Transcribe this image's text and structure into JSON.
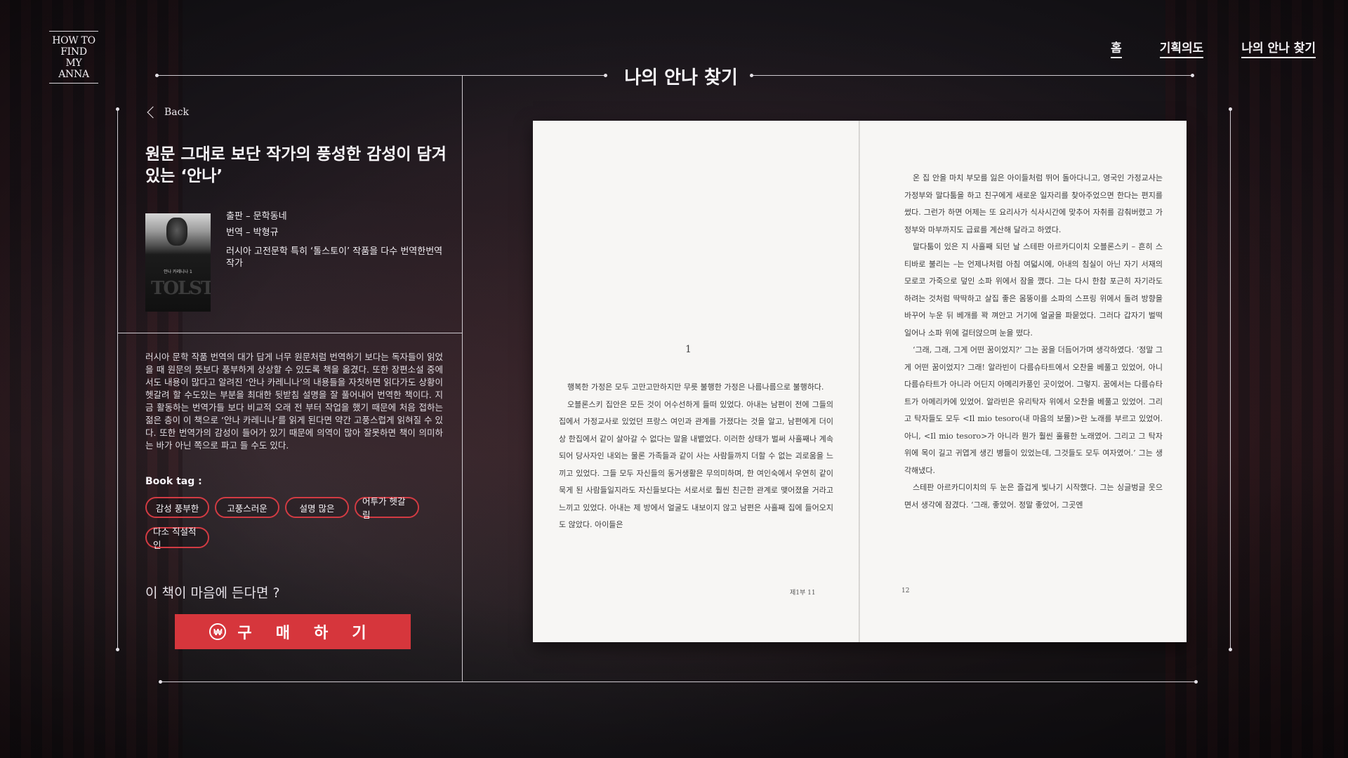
{
  "logo": {
    "line1": "HOW TO",
    "line2": "FIND",
    "line3": "MY ANNA"
  },
  "nav": {
    "home": "홈",
    "plan": "기획의도",
    "find": "나의 안나 찾기"
  },
  "page_title": "나의 안나 찾기",
  "back_label": "Back",
  "headline": "원문 그대로 보단 작가의 풍성한 감성이 담겨 있는 ‘안나’",
  "cover": {
    "title_small": "안나 카레니나 1",
    "title_big": "TOLST"
  },
  "meta": {
    "publisher": "출판 – 문학동네",
    "translator": "번역 – 박형규",
    "note": "러시아 고전문학 특히 ‘톨스토이’ 작품을 다수 번역한번역작가"
  },
  "description": "러시아 문학 작품 번역의 대가 답게 너무 원문처럼 번역하기 보다는 독자들이 읽었을 때 원문의 뜻보다 풍부하게 상상할 수 있도록 책을 옮겼다. 또한 장편소설 중에서도 내용이 많다고 알려진 ‘안나 카레니나’의 내용들을 자칫하면 읽다가도 상황이 헷갈려 할 수도있는 부분을 최대한 뒷받침 설명을 잘 풀어내어 번역한 책이다. 지금 활동하는 번역가들 보다 비교적 오래 전 부터 작업을 했기 때문에 처음 접하는 젊은 층이 이 책으로 ‘안나 카레니나’를 읽게 된다면 약간 고풍스럽게 읽혀질 수 있다. 또한 번역가의 감성이 들어가 있기 때문에 의역이 많아 잘못하면 책이 의미하는 바가 아닌 쪽으로 파고 들 수도 있다.",
  "tag_title": "Book tag :",
  "tags": [
    "감성 풍부한",
    "고풍스러운",
    "설명 많은",
    "어투가 헷갈림",
    "다소 직설적인"
  ],
  "prompt": "이 책이 마음에 든다면 ?",
  "buy": {
    "icon": "₩",
    "label": "구 매 하 기"
  },
  "book": {
    "chapter_number": "1",
    "left_p1": "행복한 가정은 모두 고만고만하지만 무릇 불행한 가정은 나름나름으로 불행하다.",
    "left_p2": "오블론스키 집안은 모든 것이 어수선하게 들떠 있었다. 아내는 남편이 전에 그들의 집에서 가정교사로 있었던 프랑스 여인과 관계를 가졌다는 것을 알고, 남편에게 더이상 한집에서 같이 살아갈 수 없다는 말을 내뱉었다. 이러한 상태가 벌써 사흘째나 계속되어 당사자인 내외는 물론 가족들과 같이 사는 사람들까지 더할 수 없는 괴로움을 느끼고 있었다. 그들 모두 자신들의 동거생활은 무의미하며, 한 여인숙에서 우연히 같이 묵게 된 사람들일지라도 자신들보다는 서로서로 훨씬 친근한 관계로 맺어졌을 거라고 느끼고 있었다. 아내는 제 방에서 얼굴도 내보이지 않고 남편은 사흘째 집에 들어오지도 않았다. 아이들은",
    "left_folio": "제1부   11",
    "right_p1": "온 집 안을 마치 부모를 잃은 아이들처럼 뛰어 돌아다니고, 영국인 가정교사는 가정부와 말다툼을 하고 친구에게 새로운 일자리를 찾아주었으면 한다는 편지를 썼다. 그런가 하면 어제는 또 요리사가 식사시간에 맞추어 자취를 감춰버렸고 가정부와 마부까지도 급료를 계산해 달라고 하였다.",
    "right_p2": "말다툼이 있은 지 사흘째 되던 날 스테판 아르카디이치 오블론스키 – 흔히 스티바로 불리는 –는 언제나처럼 아침 여덟시에, 아내의 침실이 아닌 자기 서재의 모로코 가죽으로 덮인 소파 위에서 잠을 깼다. 그는 다시 한참 포근히 자기라도 하려는 것처럼 딱딱하고 살집 좋은 몸뚱이를 소파의 스프링 위에서 돌려 방향을 바꾸어 누운 뒤 베개를 꽉 껴안고 거기에 얼굴을 파묻었다. 그러다 갑자기 벌떡 일어나 소파 위에 걸터앉으며 눈을 떴다.",
    "right_p3": "‘그래, 그래, 그게 어떤 꿈이었지?’ 그는 꿈을 더듬어가며 생각하였다. ‘정말 그게 어떤 꿈이었지? 그래! 알라빈이 다름슈타트에서 오찬을 베풀고 있었어, 아니 다름슈타트가 아니라 어딘지 아메리카풍인 곳이었어. 그렇지. 꿈에서는 다름슈타트가 아메리카에 있었어. 알라빈은 유리탁자 위에서 오찬을 베풀고 있었어. 그리고 탁자들도 모두 <Il mio tesoro(내 마음의 보물)>란 노래를 부르고 있었어. 아니, <Il mio tesoro>가 아니라 뭔가 훨씬 훌륭한 노래였어. 그리고 그 탁자 위에 목이 길고 귀엽게 생긴 병들이 있었는데, 그것들도 모두 여자였어.’ 그는 생각해냈다.",
    "right_p4": "스테판 아르카디이치의 두 눈은 즐겁게 빛나기 시작했다. 그는 싱글벙글 웃으면서 생각에 잠겼다. ‘그래, 좋았어. 정말 좋았어, 그곳엔",
    "right_folio": "12"
  }
}
